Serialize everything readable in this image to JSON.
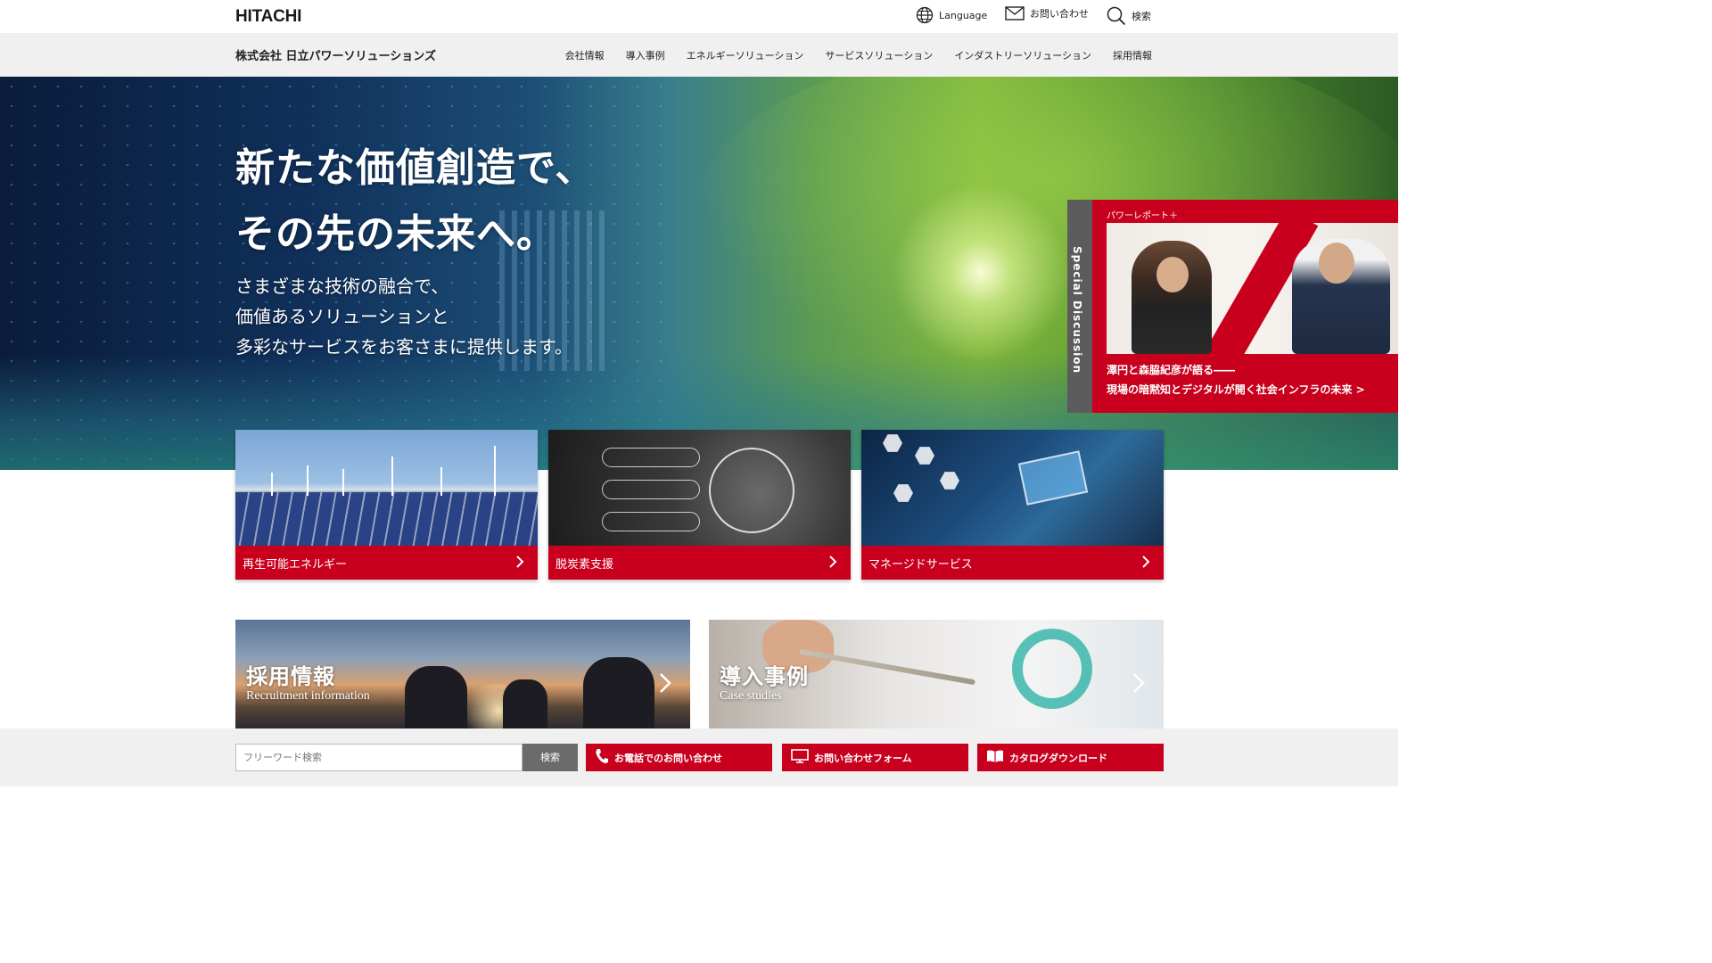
{
  "header": {
    "logo": "HITACHI",
    "language": "Language",
    "contact": "お問い合わせ",
    "search": "検索"
  },
  "nav": {
    "company": "株式会社 日立パワーソリューションズ",
    "items": [
      "会社情報",
      "導入事例",
      "エネルギーソリューション",
      "サービスソリューション",
      "インダストリーソリューション",
      "採用情報"
    ]
  },
  "hero": {
    "title_line1": "新たな価値創造で、",
    "title_line2": "その先の未来へ。",
    "sub_line1": "さまざまな技術の融合で、",
    "sub_line2": "価値あるソリューションと",
    "sub_line3": "多彩なサービスをお客さまに提供します。"
  },
  "special": {
    "side_label": "Special Discussion",
    "label": "パワーレポート＋",
    "caption_line1": "澤円と森脇紀彦が語る――",
    "caption_line2": "現場の暗黙知とデジタルが開く社会インフラの未来 >"
  },
  "cards": [
    {
      "label": "再生可能エネルギー"
    },
    {
      "label": "脱炭素支援"
    },
    {
      "label": "マネージドサービス"
    }
  ],
  "links": [
    {
      "title": "採用情報",
      "subtitle": "Recruitment information"
    },
    {
      "title": "導入事例",
      "subtitle": "Case studies"
    }
  ],
  "footer": {
    "search_placeholder": "フリーワード検索",
    "search_button": "検索",
    "phone": "お電話でのお問い合わせ",
    "form": "お問い合わせフォーム",
    "catalog": "カタログダウンロード"
  },
  "colors": {
    "brand_red": "#c8001e",
    "nav_bg": "#f0f0f0",
    "search_button_bg": "#6b6b6b"
  }
}
